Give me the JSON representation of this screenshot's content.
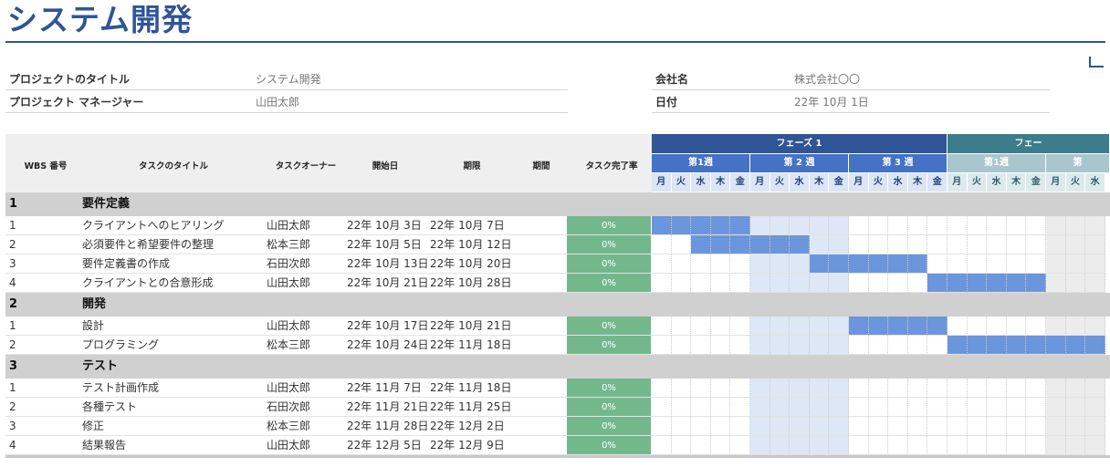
{
  "title": "システム開発",
  "meta": {
    "project_title_label": "プロジェクトのタイトル",
    "project_title_value": "システム開発",
    "pm_label": "プロジェクト マネージャー",
    "pm_value": "山田太郎",
    "company_label": "会社名",
    "company_value": "株式会社〇〇",
    "date_label": "日付",
    "date_value": "22年 10月 1日"
  },
  "columns": {
    "wbs": "WBS 番号",
    "task": "タスクのタイトル",
    "owner": "タスクオーナー",
    "start": "開始日",
    "end": "期限",
    "duration": "期間",
    "percent": "タスク完了率"
  },
  "phases": [
    {
      "label": "フェーズ 1",
      "color": "#2f5597"
    },
    {
      "label": "フェー",
      "color": "#3b7d8a"
    }
  ],
  "weeks": [
    {
      "label": "第1週",
      "color": "#4472c4"
    },
    {
      "label": "第 2 週",
      "color": "#4472c4"
    },
    {
      "label": "第 3 週",
      "color": "#4472c4"
    },
    {
      "label": "第1週",
      "color": "#a9c6cf"
    },
    {
      "label": "第",
      "color": "#a9c6cf"
    }
  ],
  "days": [
    "月",
    "火",
    "水",
    "木",
    "金",
    "月",
    "火",
    "水",
    "木",
    "金",
    "月",
    "火",
    "水",
    "木",
    "金",
    "月",
    "火",
    "水",
    "木",
    "金",
    "月",
    "火",
    "水"
  ],
  "colors": {
    "section_bg": "#d0d0d0",
    "bar": "#6c96db",
    "week2_shade": "#dde7f5",
    "week5_shade": "#ececec",
    "day_row_phase1": "#dbe5f4",
    "day_row_phase2": "#ddeaed"
  },
  "rows": [
    {
      "type": "section",
      "num": "1",
      "title": "要件定義"
    },
    {
      "type": "task",
      "num": "1",
      "title": "クライアントへのヒアリング",
      "owner": "山田太郎",
      "start": "22年 10月 3日",
      "end": "22年 10月 7日",
      "pct": "0%",
      "bar": [
        0,
        5
      ]
    },
    {
      "type": "task",
      "num": "2",
      "title": "必須要件と希望要件の整理",
      "owner": "松本三郎",
      "start": "22年 10月 5日",
      "end": "22年 10月 12日",
      "pct": "0%",
      "bar": [
        2,
        8
      ]
    },
    {
      "type": "task",
      "num": "3",
      "title": "要件定義書の作成",
      "owner": "石田次郎",
      "start": "22年 10月 13日",
      "end": "22年 10月 20日",
      "pct": "0%",
      "bar": [
        8,
        14
      ]
    },
    {
      "type": "task",
      "num": "4",
      "title": "クライアントとの合意形成",
      "owner": "山田太郎",
      "start": "22年 10月 21日",
      "end": "22年 10月 28日",
      "pct": "0%",
      "bar": [
        14,
        20
      ]
    },
    {
      "type": "section",
      "num": "2",
      "title": "開発"
    },
    {
      "type": "task",
      "num": "1",
      "title": "設計",
      "owner": "山田太郎",
      "start": "22年 10月 17日",
      "end": "22年 10月 21日",
      "pct": "0%",
      "bar": [
        10,
        15
      ]
    },
    {
      "type": "task",
      "num": "2",
      "title": "プログラミング",
      "owner": "松本三郎",
      "start": "22年 10月 24日",
      "end": "22年 11月 18日",
      "pct": "0%",
      "bar": [
        15,
        23
      ]
    },
    {
      "type": "section",
      "num": "3",
      "title": "テスト"
    },
    {
      "type": "task",
      "num": "1",
      "title": "テスト計画作成",
      "owner": "山田太郎",
      "start": "22年 11月 7日",
      "end": "22年 11月 18日",
      "pct": "0%",
      "bar": null
    },
    {
      "type": "task",
      "num": "2",
      "title": "各種テスト",
      "owner": "石田次郎",
      "start": "22年 11月 21日",
      "end": "22年 11月 25日",
      "pct": "0%",
      "bar": null
    },
    {
      "type": "task",
      "num": "3",
      "title": "修正",
      "owner": "松本三郎",
      "start": "22年 11月 28日",
      "end": "22年 12月 2日",
      "pct": "0%",
      "bar": null
    },
    {
      "type": "task",
      "num": "4",
      "title": "結果報告",
      "owner": "山田太郎",
      "start": "22年 12月 5日",
      "end": "22年 12月 9日",
      "pct": "0%",
      "bar": null
    }
  ]
}
